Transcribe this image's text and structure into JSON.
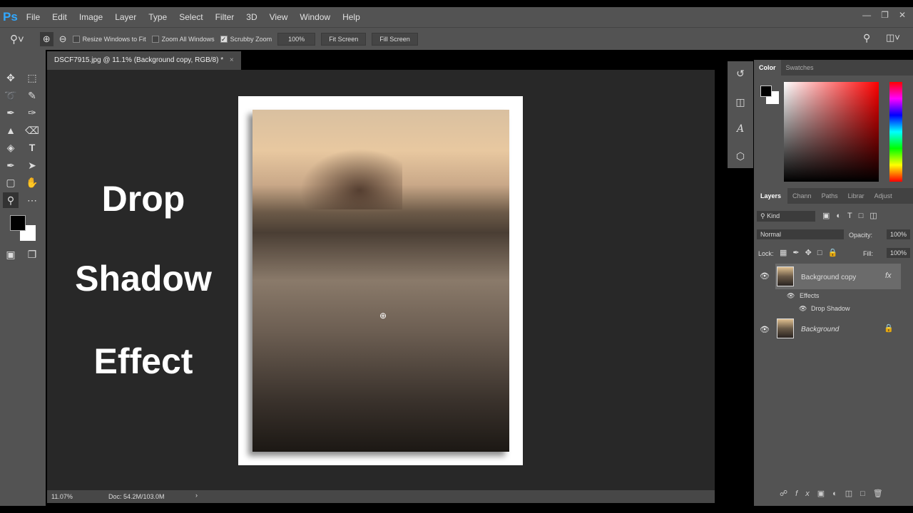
{
  "app": {
    "logo": "Ps",
    "menus": [
      "File",
      "Edit",
      "Image",
      "Layer",
      "Type",
      "Select",
      "Filter",
      "3D",
      "View",
      "Window",
      "Help"
    ]
  },
  "options": {
    "resize": "Resize Windows to Fit",
    "zoom_all": "Zoom All Windows",
    "scrubby": "Scrubby Zoom",
    "zoom_value": "100%",
    "fit": "Fit Screen",
    "fill": "Fill Screen"
  },
  "document": {
    "tab": "DSCF7915.jpg @ 11.1% (Background copy, RGB/8) *",
    "zoom": "11.07%",
    "doc_size": "Doc: 54.2M/103.0M"
  },
  "overlay_text": [
    "Drop",
    "Shadow",
    "Effect"
  ],
  "color_panel": {
    "tabs": [
      "Color",
      "Swatches"
    ],
    "foreground": "#000000",
    "background": "#ffffff",
    "hue": "#ff0000"
  },
  "layers_panel": {
    "tabs": [
      "Layers",
      "Chann",
      "Paths",
      "Librar",
      "Adjust"
    ],
    "filter": "Kind",
    "blend_mode": "Normal",
    "opacity_label": "Opacity:",
    "opacity": "100%",
    "lock_label": "Lock:",
    "fill_label": "Fill:",
    "fill": "100%",
    "layers": [
      {
        "name": "Background copy",
        "fx": "fx",
        "effects_label": "Effects",
        "effects": [
          "Drop Shadow"
        ]
      },
      {
        "name": "Background"
      }
    ]
  }
}
